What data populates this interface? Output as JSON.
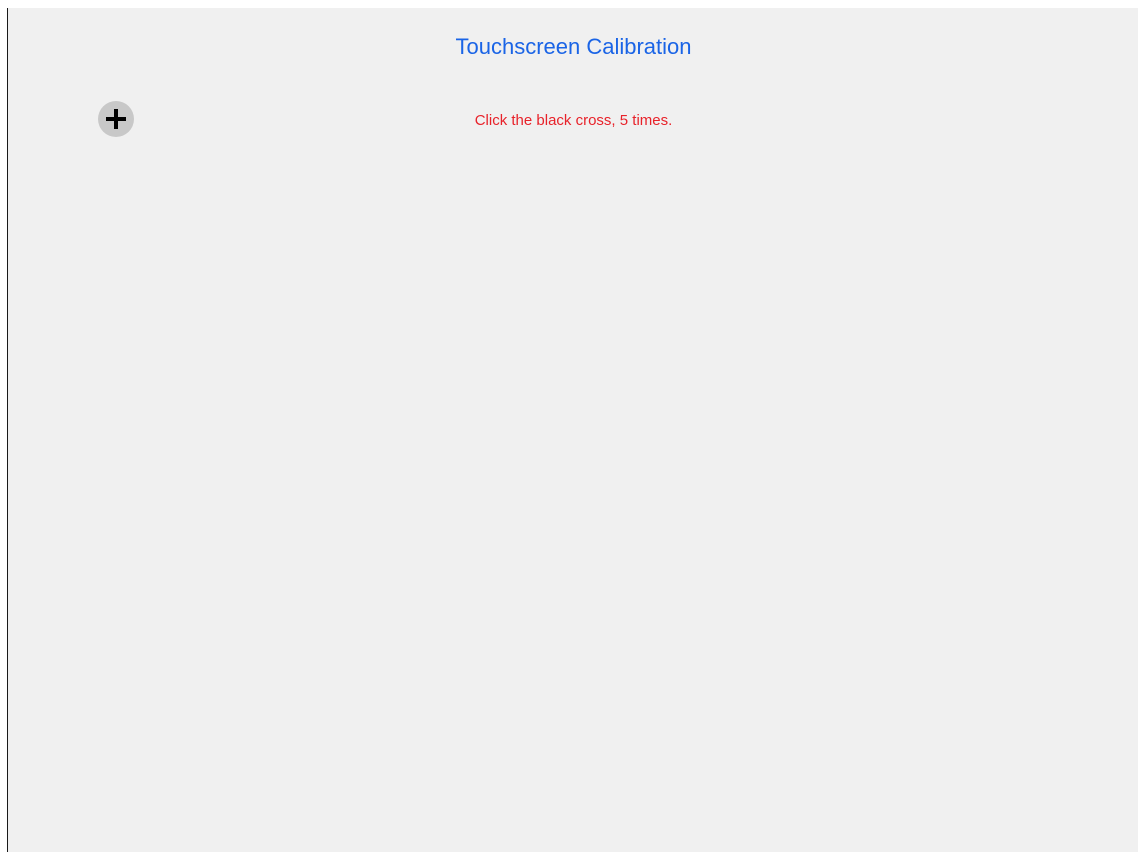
{
  "app": {
    "title": "Touchscreen Calibration"
  },
  "instruction": {
    "text": "Click the black cross, 5 times."
  },
  "target": {
    "icon": "crosshair-plus-icon",
    "background_color": "#c8c8c8",
    "cross_color": "#000000"
  },
  "colors": {
    "title": "#1a64e6",
    "instruction": "#e8222a",
    "panel_background": "#f0f0f0"
  }
}
